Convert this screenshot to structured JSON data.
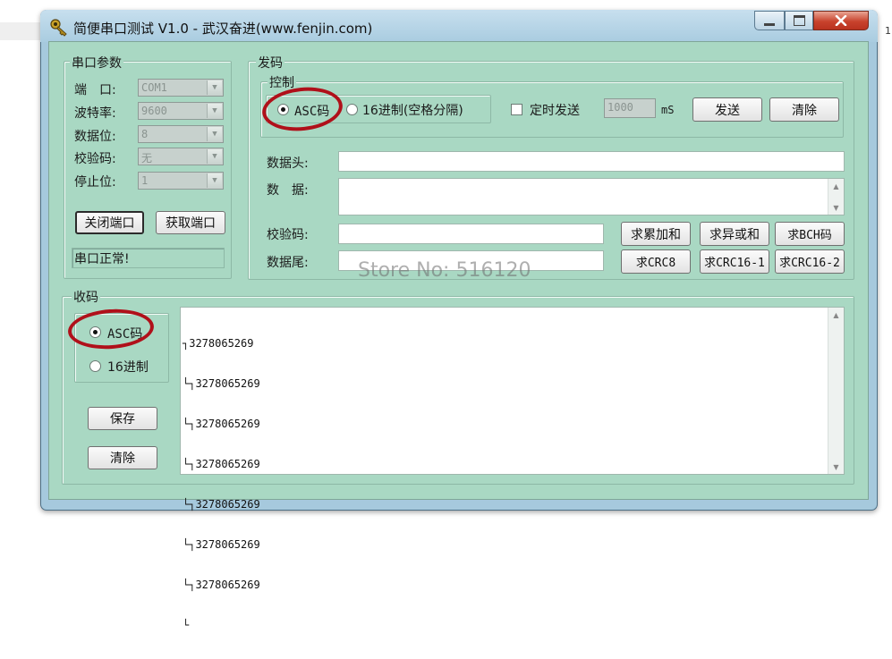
{
  "window": {
    "title": "简便串口测试 V1.0 - 武汉奋进(www.fenjin.com)"
  },
  "edge_text": "1",
  "serial": {
    "group_label": "串口参数",
    "fields": [
      {
        "label": "端　口:",
        "value": "COM1"
      },
      {
        "label": "波特率:",
        "value": "9600"
      },
      {
        "label": "数据位:",
        "value": "8"
      },
      {
        "label": "校验码:",
        "value": "无"
      },
      {
        "label": "停止位:",
        "value": "1"
      }
    ],
    "close_port_label": "关闭端口",
    "get_port_label": "获取端口",
    "status_text": "串口正常!"
  },
  "send": {
    "group_label": "发码",
    "control_label": "控制",
    "asc_label": "ASC码",
    "hex_label": "16进制(空格分隔)",
    "timed_label": "定时发送",
    "interval_value": "1000",
    "interval_unit": "mS",
    "send_button": "发送",
    "clear_button": "清除",
    "header_label": "数据头:",
    "data_label": "数　据:",
    "checksum_label": "校验码:",
    "tail_label": "数据尾:",
    "calc_buttons": [
      "求累加和",
      "求异或和",
      "求BCH码",
      "求CRC8",
      "求CRC16-1",
      "求CRC16-2"
    ]
  },
  "receive": {
    "group_label": "收码",
    "asc_label": "ASC码",
    "hex_label": "16进制",
    "save_button": "保存",
    "clear_button": "清除",
    "lines": [
      "┐3278065269",
      "└┐3278065269",
      "└┐3278065269",
      "└┐3278065269",
      "└┐3278065269",
      "└┐3278065269",
      "└┐3278065269",
      "└"
    ]
  },
  "watermark": "Store No: 516120",
  "colors": {
    "client_bg": "#a9d8c3",
    "titlebar": "#a9cce0",
    "annotation_red": "#b0101a",
    "close_button": "#c9432d"
  },
  "icons": {
    "app": "key-icon",
    "minimize": "minimize-icon",
    "maximize": "maximize-icon",
    "close": "close-icon"
  }
}
